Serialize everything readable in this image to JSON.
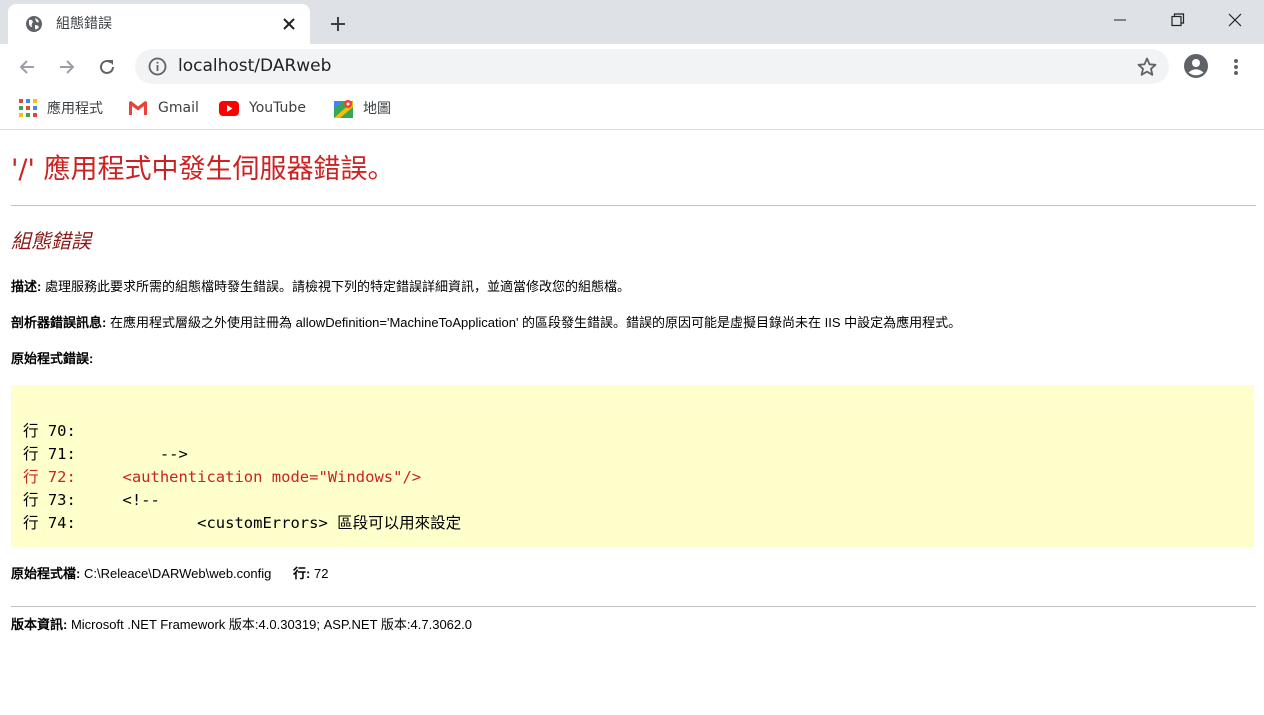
{
  "browser": {
    "tab_title": "組態錯誤",
    "url": "localhost/DARweb",
    "bookmarks": [
      {
        "label": "應用程式",
        "icon": "apps-grid-icon"
      },
      {
        "label": "Gmail",
        "icon": "gmail-icon"
      },
      {
        "label": "YouTube",
        "icon": "youtube-icon"
      },
      {
        "label": "地圖",
        "icon": "maps-icon"
      }
    ],
    "colors": {
      "tabstrip": "#dee1e6",
      "omnibox": "#f1f3f4",
      "gmail_red": "#ea4335",
      "youtube_red": "#ff0000"
    }
  },
  "error_page": {
    "title": "'/' 應用程式中發生伺服器錯誤。",
    "subtitle": "組態錯誤",
    "description_label": "描述:",
    "description_text": "處理服務此要求所需的組態檔時發生錯誤。請檢視下列的特定錯誤詳細資訊，並適當修改您的組態檔。",
    "parser_label": "剖析器錯誤訊息:",
    "parser_text": "在應用程式層級之外使用註冊為 allowDefinition='MachineToApplication' 的區段發生錯誤。錯誤的原因可能是虛擬目錄尚未在 IIS 中設定為應用程式。",
    "source_error_label": "原始程式錯誤:",
    "code_lines": [
      {
        "text": "行 70:",
        "highlight": false
      },
      {
        "text": "行 71:         -->",
        "highlight": false
      },
      {
        "text": "行 72:     <authentication mode=\"Windows\"/>",
        "highlight": true
      },
      {
        "text": "行 73:     <!--",
        "highlight": false
      },
      {
        "text": "行 74:             <customErrors> 區段可以用來設定",
        "highlight": false
      }
    ],
    "source_file_label": "原始程式檔:",
    "source_file_value": "C:\\Releace\\DARWeb\\web.config",
    "line_label": "行:",
    "line_value": "72",
    "version_label": "版本資訊:",
    "version_text": "Microsoft .NET Framework 版本:4.0.30319; ASP.NET 版本:4.7.3062.0",
    "colors": {
      "title_red": "#cc2222",
      "subtitle_red": "#8b1a1a",
      "code_bg": "#ffffcc"
    }
  }
}
